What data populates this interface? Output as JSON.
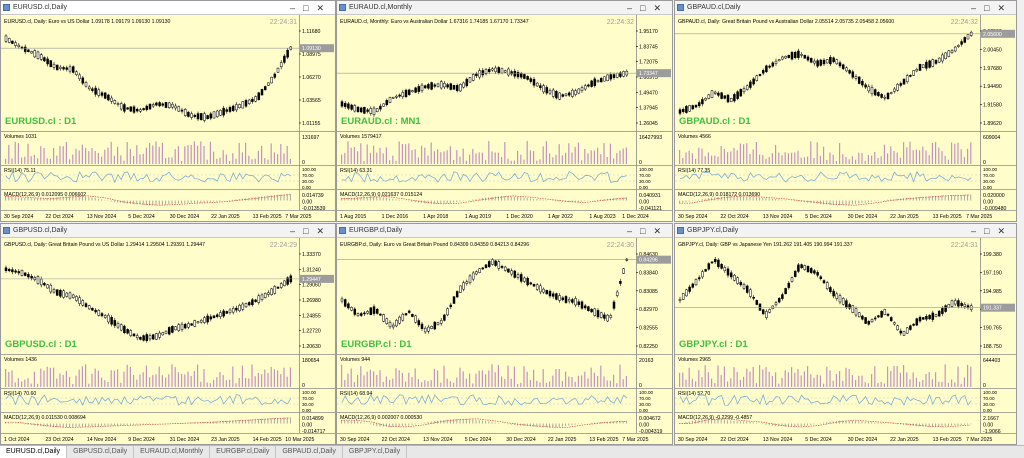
{
  "colors": {
    "background": "#fffdc9",
    "candle": "#000000",
    "symbol_label": "#3fbf3f",
    "volume_bar": "#c493c6",
    "rsi_line": "#6aa7d6",
    "macd_bar": "#a0a0a0",
    "macd_signal": "#d24a4a",
    "grid": "#c9c9c9",
    "price_tag": "#9c9c9c"
  },
  "windows": [
    {
      "title": "EURUSD.cl,Daily",
      "active": true,
      "header": "EURUSD.cl, Daily:  Euro vs US Dollar  1.09178 1.09179 1.09130 1.09130",
      "time": "22:24:31",
      "symbol_label": "EURUSD.cl : D1",
      "price_tag": "1.09130",
      "price_ticks": [
        "1.11680",
        "1.08975",
        "1.06270",
        "1.03565",
        "1.01155"
      ],
      "volume_label": "Volumes 1031",
      "volume_ticks": [
        "131697",
        "0"
      ],
      "rsi_label": "RSI(14) 75.11",
      "rsi_ticks": [
        "100.00",
        "70.00",
        "30.00",
        "0.00"
      ],
      "macd_label": "MACD(12,26,9) 0.012095 0.006602",
      "macd_ticks": [
        "0.014739",
        "0.00",
        "-0.013539"
      ],
      "dates": [
        "30 Sep 2024",
        "22 Oct 2024",
        "13 Nov 2024",
        "5 Dec 2024",
        "30 Dec 2024",
        "22 Jan 2025",
        "13 Feb 2025",
        "7 Mar 2025"
      ]
    },
    {
      "title": "EURAUD.cl,Monthly",
      "active": false,
      "header": "EURAUD.cl, Monthly:  Euro vs Australian Dollar  1.67316 1.74185 1.67170 1.73347",
      "time": "22:24:32",
      "symbol_label": "EURAUD.cl : MN1",
      "price_tag": "1.73347",
      "price_ticks": [
        "1.95170",
        "1.83745",
        "1.72075",
        "1.60975",
        "1.49470",
        "1.37945",
        "1.26045"
      ],
      "volume_label": "Volumes 1579417",
      "volume_ticks": [
        "16427993",
        "0"
      ],
      "rsi_label": "RSI(14) 63.31",
      "rsi_ticks": [
        "100.00",
        "70.00",
        "30.00",
        "0.00"
      ],
      "macd_label": "MACD(12,26,9) 0.021637 0.015124",
      "macd_ticks": [
        "0.040931",
        "0.00",
        "-0.041121"
      ],
      "dates": [
        "1 Aug 2015",
        "1 Dec 2016",
        "1 Apr 2018",
        "1 Aug 2019",
        "1 Dec 2020",
        "1 Apr 2022",
        "1 Aug 2023",
        "1 Dec 2024"
      ]
    },
    {
      "title": "GBPAUD.cl,Daily",
      "active": false,
      "header": "GBPAUD.cl, Daily:  Great Britain Pound vs Australian Dollar  2.05514 2.05735 2.05458 2.05600",
      "time": "22:24:32",
      "symbol_label": "GBPAUD.cl : D1",
      "price_tag": "2.05600",
      "price_ticks": [
        "2.03590",
        "2.00450",
        "1.97680",
        "1.94490",
        "1.91580",
        "1.89620"
      ],
      "volume_label": "Volumes 4566",
      "volume_ticks": [
        "609004",
        "0"
      ],
      "rsi_label": "RSI(14) 77.35",
      "rsi_ticks": [
        "100.00",
        "70.00",
        "30.00",
        "0.00"
      ],
      "macd_label": "MACD(12,26,9) 0.018172 0.013690",
      "macd_ticks": [
        "0.020000",
        "0.00",
        "-0.009480"
      ],
      "dates": [
        "30 Sep 2024",
        "22 Oct 2024",
        "13 Nov 2024",
        "5 Dec 2024",
        "30 Dec 2024",
        "22 Jan 2025",
        "13 Feb 2025",
        "7 Mar 2025"
      ]
    },
    {
      "title": "GBPUSD.cl,Daily",
      "active": false,
      "header": "GBPUSD.cl, Daily:  Great Britain Pound vs US Dollar  1.29414 1.29504 1.29391 1.29447",
      "time": "22:24:29",
      "symbol_label": "GBPUSD.cl : D1",
      "price_tag": "1.29447",
      "price_ticks": [
        "1.33370",
        "1.31240",
        "1.29060",
        "1.26980",
        "1.24855",
        "1.22720",
        "1.20630"
      ],
      "volume_label": "Volumes 1436",
      "volume_ticks": [
        "180654",
        "0"
      ],
      "rsi_label": "RSI(14) 70.60",
      "rsi_ticks": [
        "100.00",
        "70.00",
        "30.00",
        "0.00"
      ],
      "macd_label": "MACD(12,26,9) 0.011530 0.008694",
      "macd_ticks": [
        "0.014899",
        "0.00",
        "-0.014717"
      ],
      "dates": [
        "1 Oct 2024",
        "23 Oct 2024",
        "14 Nov 2024",
        "9 Dec 2024",
        "31 Dec 2024",
        "23 Jan 2025",
        "14 Feb 2025",
        "10 Mar 2025"
      ]
    },
    {
      "title": "EURGBP.cl,Daily",
      "active": false,
      "header": "EURGBP.cl, Daily:  Euro vs Great Britain Pound  0.84309 0.84359 0.84213 0.84296",
      "time": "22:24:30",
      "symbol_label": "EURGBP.cl : D1",
      "price_tag": "0.84296",
      "price_ticks": [
        "0.84630",
        "0.83840",
        "0.83085",
        "0.82970",
        "0.82555",
        "0.82250"
      ],
      "volume_label": "Volumes 944",
      "volume_ticks": [
        "20163",
        "0"
      ],
      "rsi_label": "RSI(14) 68.94",
      "rsi_ticks": [
        "100.00",
        "70.00",
        "30.00",
        "0.00"
      ],
      "macd_label": "MACD(12,26,9) 0.002007 0.000530",
      "macd_ticks": [
        "0.004672",
        "0.00",
        "-0.004319"
      ],
      "dates": [
        "30 Sep 2024",
        "22 Oct 2024",
        "13 Nov 2024",
        "5 Dec 2024",
        "30 Dec 2024",
        "22 Jan 2025",
        "13 Feb 2025",
        "7 Mar 2025"
      ]
    },
    {
      "title": "GBPJPY.cl,Daily",
      "active": false,
      "header": "GBPJPY.cl, Daily:  GBP vs Japanese Yen  191.262 191.405 190.994 191.337",
      "time": "22:24:31",
      "symbol_label": "GBPJPY.cl : D1",
      "price_tag": "191.337",
      "price_ticks": [
        "199.380",
        "197.190",
        "194.985",
        "192.970",
        "190.765",
        "188.750"
      ],
      "volume_label": "Volumes 2965",
      "volume_ticks": [
        "644403",
        "0"
      ],
      "rsi_label": "RSI(14) 52.70",
      "rsi_ticks": [
        "100.00",
        "70.00",
        "30.00",
        "0.00"
      ],
      "macd_label": "MACD(12,26,9) -0.2299 -0.4857",
      "macd_ticks": [
        "2.1667",
        "0.00",
        "-1.9066"
      ],
      "dates": [
        "30 Sep 2024",
        "22 Oct 2024",
        "13 Nov 2024",
        "5 Dec 2024",
        "30 Dec 2024",
        "22 Jan 2025",
        "13 Feb 2025",
        "7 Mar 2025"
      ]
    }
  ],
  "tabs": [
    "EURUSD.cl,Daily",
    "GBPUSD.cl,Daily",
    "EURAUD.cl,Monthly",
    "EURGBP.cl,Daily",
    "GBPAUD.cl,Daily",
    "GBPJPY.cl,Daily"
  ]
}
